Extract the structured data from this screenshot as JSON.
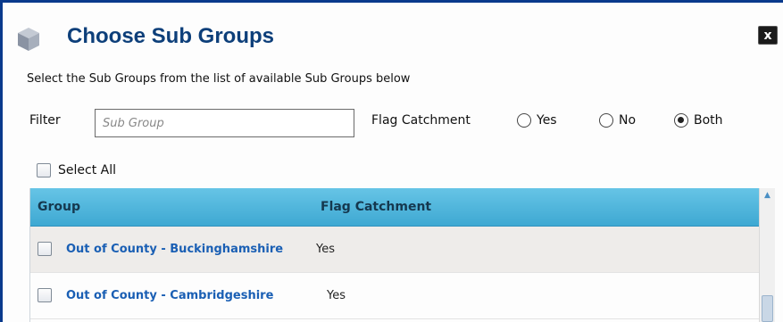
{
  "dialog": {
    "title": "Choose Sub Groups",
    "close_label": "x",
    "instructions": "Select the Sub Groups from the list of available Sub Groups below"
  },
  "filter": {
    "label": "Filter",
    "placeholder": "Sub Group",
    "value": ""
  },
  "flag_catchment": {
    "label": "Flag Catchment",
    "options": [
      {
        "label": "Yes",
        "selected": false
      },
      {
        "label": "No",
        "selected": false
      },
      {
        "label": "Both",
        "selected": true
      }
    ]
  },
  "select_all": {
    "label": "Select All",
    "checked": false
  },
  "grid": {
    "columns": [
      "Group",
      "Flag Catchment"
    ],
    "rows": [
      {
        "group": "Out of County - Buckinghamshire",
        "flag_catchment": "Yes",
        "checked": false
      },
      {
        "group": "Out of County - Cambridgeshire",
        "flag_catchment": "Yes",
        "checked": false
      }
    ]
  },
  "icons": {
    "title_icon": "cube-icon",
    "close_icon": "close-icon",
    "scroll_up": "chevron-up-icon"
  },
  "colors": {
    "title": "#0d3f7a",
    "header": "#3ea8d2",
    "link": "#1a5fb4",
    "border": "#0a3a8c"
  }
}
